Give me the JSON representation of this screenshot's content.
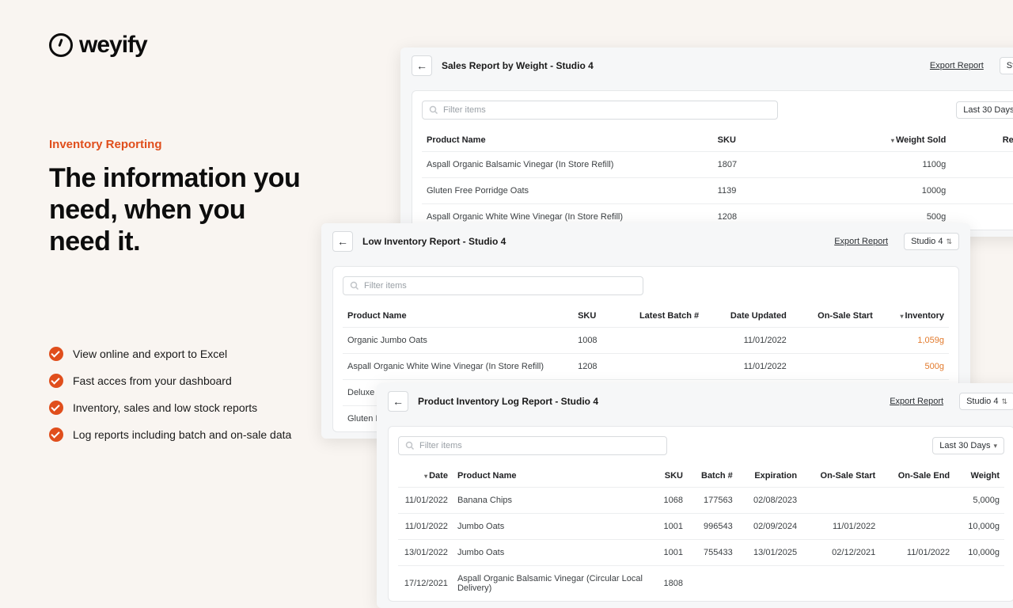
{
  "brand": {
    "name": "weyify"
  },
  "hero": {
    "eyebrow": "Inventory Reporting",
    "headline": "The information you need, when you need it."
  },
  "bullets": [
    "View online and export to Excel",
    "Fast acces from your dashboard",
    "Inventory, sales and low stock reports",
    "Log reports including batch and on-sale data"
  ],
  "ui": {
    "export": "Export Report",
    "filter_placeholder": "Filter items",
    "studio_pill": "Studio 4",
    "last30": "Last 30 Days",
    "studio_cut": "Studio"
  },
  "sales": {
    "title": "Sales Report by Weight - Studio 4",
    "cols": {
      "product": "Product Name",
      "sku": "SKU",
      "weight_sold": "Weight Sold",
      "revenue": "Reve"
    },
    "rows": [
      {
        "product": "Aspall Organic Balsamic Vinegar (In Store Refill)",
        "sku": "1807",
        "weight": "1100g"
      },
      {
        "product": "Gluten Free Porridge Oats",
        "sku": "1139",
        "weight": "1000g"
      },
      {
        "product": "Aspall Organic White Wine Vinegar (In Store Refill)",
        "sku": "1208",
        "weight": "500g"
      }
    ]
  },
  "low": {
    "title": "Low Inventory Report - Studio 4",
    "cols": {
      "product": "Product Name",
      "sku": "SKU",
      "batch": "Latest Batch #",
      "updated": "Date Updated",
      "onsale": "On-Sale Start",
      "inventory": "Inventory"
    },
    "rows": [
      {
        "product": "Organic Jumbo Oats",
        "sku": "1008",
        "batch": "",
        "updated": "11/01/2022",
        "onsale": "",
        "inventory": "1,059g"
      },
      {
        "product": "Aspall Organic White Wine Vinegar (In Store Refill)",
        "sku": "1208",
        "batch": "",
        "updated": "11/01/2022",
        "onsale": "",
        "inventory": "500g"
      },
      {
        "product": "Deluxe M",
        "sku": "",
        "batch": "",
        "updated": "",
        "onsale": "",
        "inventory": ""
      },
      {
        "product": "Gluten Fr",
        "sku": "",
        "batch": "",
        "updated": "",
        "onsale": "",
        "inventory": ""
      }
    ]
  },
  "log": {
    "title": "Product Inventory Log Report - Studio 4",
    "cols": {
      "date": "Date",
      "product": "Product Name",
      "sku": "SKU",
      "batch": "Batch #",
      "expiration": "Expiration",
      "onsale_start": "On-Sale Start",
      "onsale_end": "On-Sale End",
      "weight": "Weight"
    },
    "rows": [
      {
        "date": "11/01/2022",
        "product": "Banana Chips",
        "sku": "1068",
        "batch": "177563",
        "expiration": "02/08/2023",
        "onsale_start": "",
        "onsale_end": "",
        "weight": "5,000g"
      },
      {
        "date": "11/01/2022",
        "product": "Jumbo Oats",
        "sku": "1001",
        "batch": "996543",
        "expiration": "02/09/2024",
        "onsale_start": "11/01/2022",
        "onsale_end": "",
        "weight": "10,000g"
      },
      {
        "date": "13/01/2022",
        "product": "Jumbo Oats",
        "sku": "1001",
        "batch": "755433",
        "expiration": "13/01/2025",
        "onsale_start": "02/12/2021",
        "onsale_end": "11/01/2022",
        "weight": "10,000g"
      },
      {
        "date": "17/12/2021",
        "product": "Aspall Organic Balsamic Vinegar (Circular Local Delivery)",
        "sku": "1808",
        "batch": "",
        "expiration": "",
        "onsale_start": "",
        "onsale_end": "",
        "weight": ""
      }
    ]
  }
}
